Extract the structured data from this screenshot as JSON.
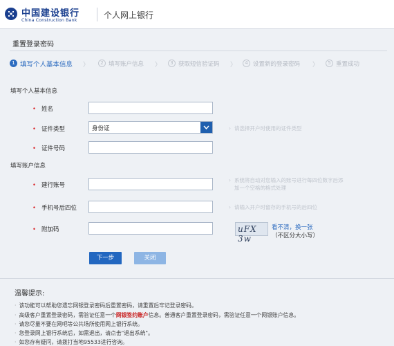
{
  "header": {
    "bank_name_cn": "中国建设银行",
    "bank_name_en": "China Construction Bank",
    "site_name": "个人网上银行"
  },
  "page": {
    "title": "重置登录密码"
  },
  "steps": [
    {
      "num": "1",
      "label": "填写个人基本信息",
      "active": true
    },
    {
      "num": "2",
      "label": "填写账户信息",
      "active": false
    },
    {
      "num": "3",
      "label": "获取短信验证码",
      "active": false
    },
    {
      "num": "4",
      "label": "设置新的登录密码",
      "active": false
    },
    {
      "num": "5",
      "label": "重置成功",
      "active": false
    }
  ],
  "section_personal": {
    "title": "填写个人基本信息",
    "name_label": "姓名",
    "id_type_label": "证件类型",
    "id_type_value": "身份证",
    "id_type_hint": "请选择开户时使用的证件类型",
    "id_number_label": "证件号码"
  },
  "section_account": {
    "title": "填写账户信息",
    "account_label": "建行账号",
    "account_hint_1": "系统将自动对您输入的账号进行每四位数字后添",
    "account_hint_2": "加一个空格的格式处理",
    "phone_label": "手机号后四位",
    "phone_hint": "请输入开户时留存的手机号的后四位",
    "captcha_label": "附加码",
    "captcha_text": "uFX 3w",
    "captcha_refresh": "看不清，换一张",
    "captcha_note": "（不区分大小写）"
  },
  "buttons": {
    "next": "下一步",
    "close": "关闭"
  },
  "tips": {
    "title": "温馨提示:",
    "items": [
      "该功能可以帮助您遗忘网银登录密码后重置密码，请重置后牢记登录密码。",
      "普通客户重置登录密码，需验证任意一个网银账户信息。",
      "请您尽量不要在网吧等公共场所使用网上银行系统。",
      "您登录网上银行系统后，如需退出，请点击\"退出系统\"。",
      "如您存有疑问，请拨打当地95533进行咨询。"
    ],
    "item2_prefix": "高级客户重置登录密码，需验证任意一个",
    "item2_highlight": "网银签约账户",
    "item2_suffix": "信息。普通客户重置登录密码，需验证任意一个网银账户信息。"
  },
  "colors": {
    "brand": "#1a3f8f",
    "primary_button": "#2267c0",
    "disabled_button": "#8db5e4",
    "required": "#d9262a"
  }
}
